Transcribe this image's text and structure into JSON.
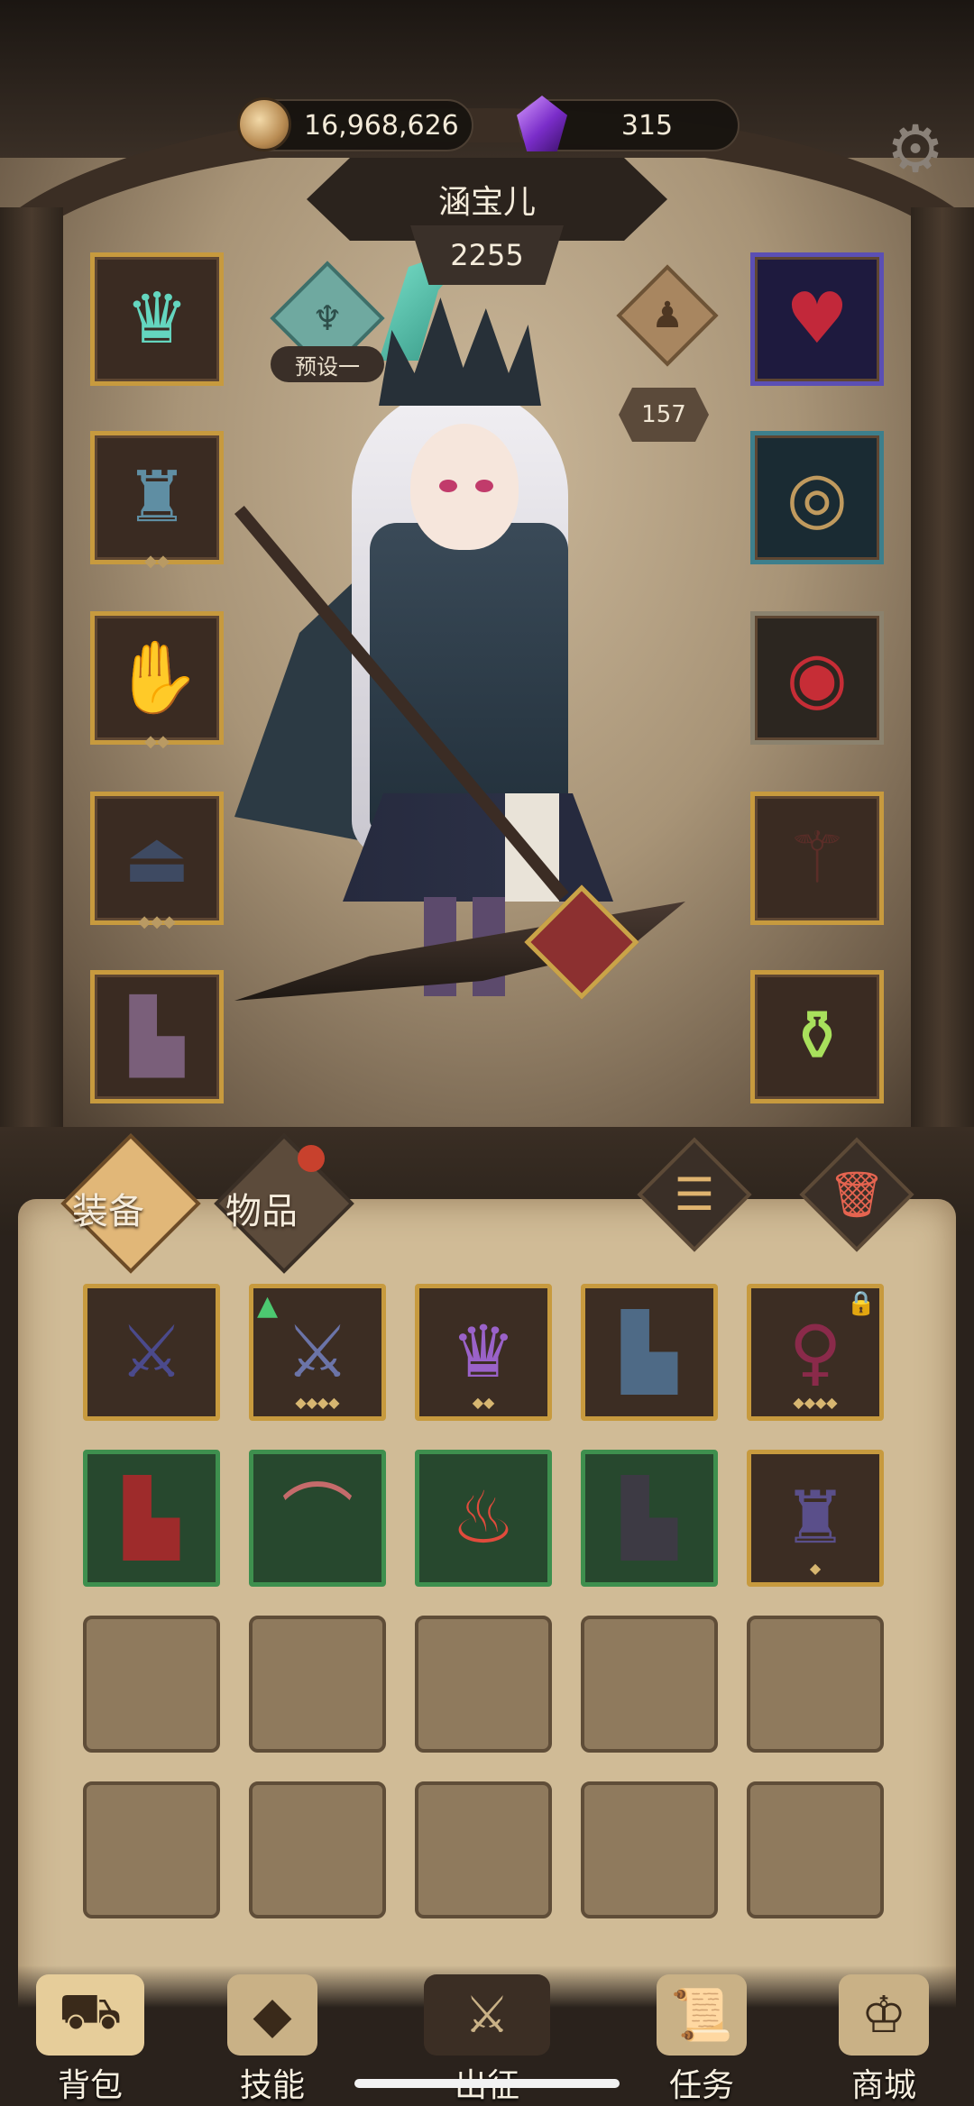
{
  "header": {
    "gold": "16,968,626",
    "gems": "315",
    "hero_name": "涵宝儿",
    "power": "2255",
    "preset_label": "预设一",
    "level": "157"
  },
  "equipped_left": [
    {
      "slot": "helm",
      "icon": "teal-crown-icon",
      "rarity": "gold"
    },
    {
      "slot": "armor",
      "icon": "dark-coat-icon",
      "rarity": "gold"
    },
    {
      "slot": "gloves",
      "icon": "gauntlet-icon",
      "rarity": "gold"
    },
    {
      "slot": "skirt",
      "icon": "skirt-icon",
      "rarity": "gold"
    },
    {
      "slot": "boots",
      "icon": "boots-icon",
      "rarity": "gold"
    }
  ],
  "equipped_right": [
    {
      "slot": "necklace",
      "icon": "ruby-amulet-icon",
      "rarity": "epic"
    },
    {
      "slot": "ring1",
      "icon": "gold-ring-icon",
      "rarity": "rare"
    },
    {
      "slot": "ring2",
      "icon": "ruby-ring-icon",
      "rarity": "plain"
    },
    {
      "slot": "weapon",
      "icon": "scythe-icon",
      "rarity": "gold"
    },
    {
      "slot": "potion",
      "icon": "green-potion-icon",
      "rarity": "gold"
    }
  ],
  "tabs": {
    "equipment": "装备",
    "items": "物品"
  },
  "inventory": [
    {
      "icon": "scythe-icon",
      "rarity": "gold"
    },
    {
      "icon": "scythe-icon",
      "rarity": "gold",
      "upgrade": true
    },
    {
      "icon": "purple-helm-icon",
      "rarity": "gold"
    },
    {
      "icon": "armored-boots-icon",
      "rarity": "gold"
    },
    {
      "icon": "dress-icon",
      "rarity": "gold",
      "locked": true
    },
    {
      "icon": "red-boots-icon",
      "rarity": "green"
    },
    {
      "icon": "gem-necklace-icon",
      "rarity": "green"
    },
    {
      "icon": "flame-icon",
      "rarity": "green"
    },
    {
      "icon": "leather-boots-icon",
      "rarity": "green"
    },
    {
      "icon": "robe-icon",
      "rarity": "gold"
    }
  ],
  "nav": {
    "bag": "背包",
    "skills": "技能",
    "battle": "出征",
    "tasks": "任务",
    "shop": "商城"
  },
  "colors": {
    "gold_border": "#c79a3e",
    "green_border": "#3e8f4e",
    "parchment": "#d0bb96",
    "red_dot": "#c8412d"
  }
}
